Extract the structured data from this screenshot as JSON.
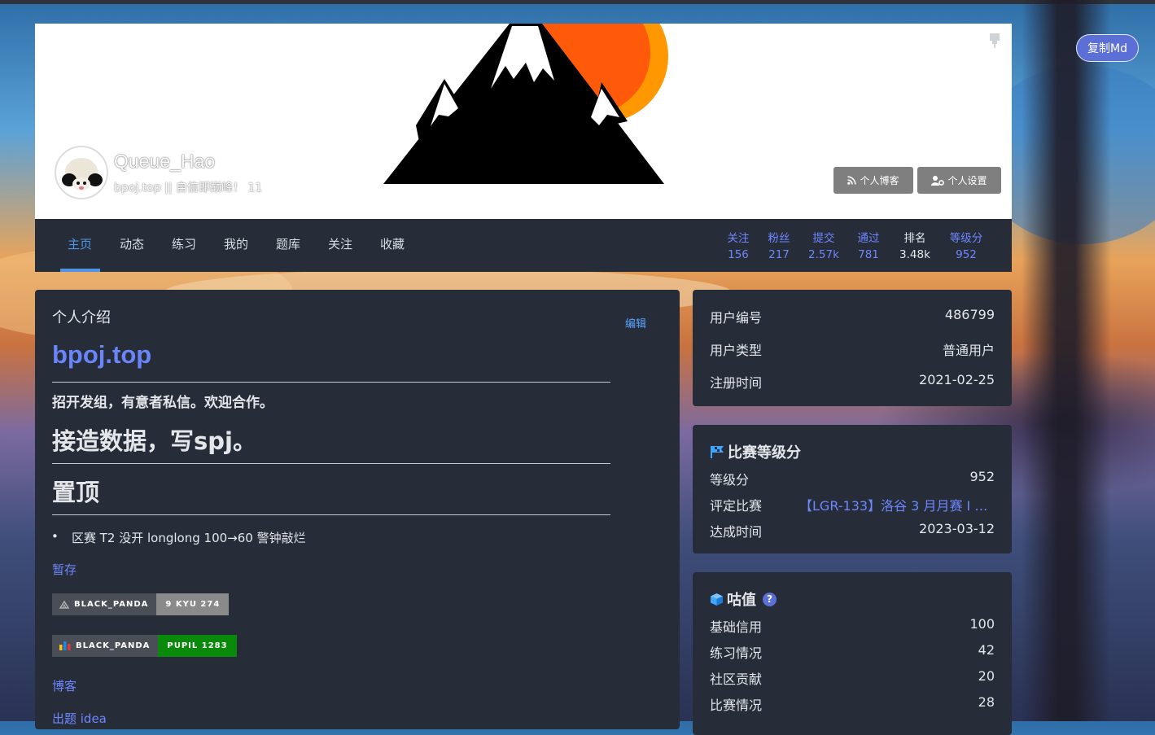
{
  "header": {
    "username": "Queue_Hao",
    "slogan": "bpoj.top || 自信即巅峰！ 11",
    "blog_button": "个人博客",
    "settings_button": "个人设置",
    "copy_md_button": "复制Md"
  },
  "nav": {
    "tabs": [
      "主页",
      "动态",
      "练习",
      "我的",
      "题库",
      "关注",
      "收藏"
    ],
    "active_tab": "主页",
    "stats": [
      {
        "label": "关注",
        "value": "156"
      },
      {
        "label": "粉丝",
        "value": "217"
      },
      {
        "label": "提交",
        "value": "2.57k"
      },
      {
        "label": "通过",
        "value": "781"
      },
      {
        "label": "排名",
        "value": "3.48k"
      },
      {
        "label": "等级分",
        "value": "952"
      }
    ]
  },
  "intro": {
    "title": "个人介绍",
    "edit": "编辑",
    "heading_link": "bpoj.top",
    "line1": "招开发组，有意者私信。欢迎合作。",
    "heading2": "接造数据，写spj。",
    "heading3": "置顶",
    "bullet": "区赛 T2 没开 longlong 100→60 警钟敲烂",
    "link_temp": "暂存",
    "badge1": {
      "left": "BLACK_PANDA",
      "right": "9 KYU 274",
      "right_color": "#8a8a8a"
    },
    "badge2": {
      "left": "BLACK_PANDA",
      "right": "PUPIL 1283",
      "right_color": "#0a8a0a"
    },
    "link_blog": "博客",
    "link_idea": "出题 idea"
  },
  "user_info": {
    "rows": [
      {
        "label": "用户编号",
        "value": "486799"
      },
      {
        "label": "用户类型",
        "value": "普通用户"
      },
      {
        "label": "注册时间",
        "value": "2021-02-25"
      }
    ]
  },
  "contest_rating": {
    "title": "比赛等级分",
    "rows": [
      {
        "label": "等级分",
        "value": "952"
      },
      {
        "label": "评定比赛",
        "value": "【LGR-133】洛谷 3 月月赛 I & ..."
      },
      {
        "label": "达成时间",
        "value": "2023-03-12"
      }
    ]
  },
  "gugu_value": {
    "title": "咕值",
    "help": "?",
    "rows": [
      {
        "label": "基础信用",
        "value": "100"
      },
      {
        "label": "练习情况",
        "value": "42"
      },
      {
        "label": "社区贡献",
        "value": "20"
      },
      {
        "label": "比赛情况",
        "value": "28"
      }
    ]
  },
  "icons": [
    "mountain-sun-banner",
    "pin-icon",
    "rss-icon",
    "user-cog-icon",
    "flag-icon",
    "cube-icon",
    "help-icon",
    "avatar-panda"
  ],
  "colors": {
    "accent": "#4e95e7",
    "link": "#6e86ff",
    "panel": "#262d39",
    "copy_button": "#5b6fd6"
  }
}
